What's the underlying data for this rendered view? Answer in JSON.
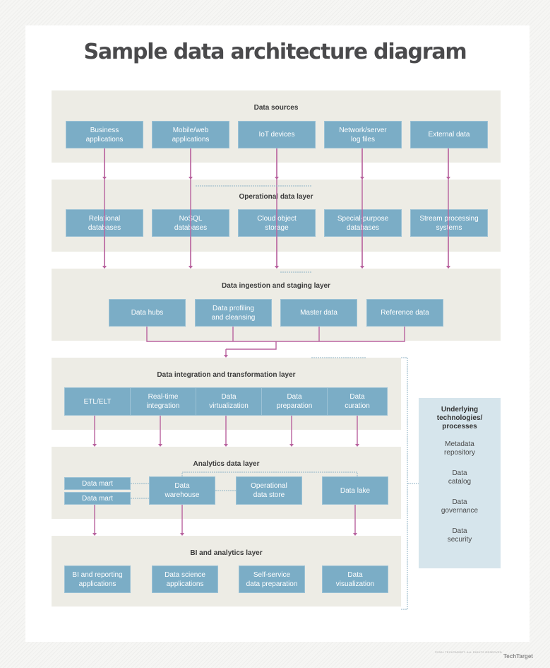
{
  "title": "Sample data architecture diagram",
  "colors": {
    "layer_bg": "#edece5",
    "box_bg": "#7badc6",
    "arrow": "#b8629e",
    "side_bg": "#d6e5ec",
    "dotted": "#8fb3c6"
  },
  "layers": [
    {
      "title": "Data sources",
      "items": [
        "Business\napplications",
        "Mobile/web\napplications",
        "IoT devices",
        "Network/server\nlog files",
        "External data"
      ]
    },
    {
      "title": "Operational data layer",
      "items": [
        "Relational\ndatabases",
        "NoSQL\ndatabases",
        "Cloud object\nstorage",
        "Special-purpose\ndatabases",
        "Stream processing\nsystems"
      ]
    },
    {
      "title": "Data ingestion and staging layer",
      "items": [
        "Data hubs",
        "Data profiling\nand cleansing",
        "Master data",
        "Reference data"
      ]
    },
    {
      "title": "Data integration and transformation layer",
      "items": [
        "ETL/ELT",
        "Real-time\nintegration",
        "Data\nvirtualization",
        "Data\npreparation",
        "Data\ncuration"
      ]
    },
    {
      "title": "Analytics data layer",
      "items": [
        "Data mart",
        "Data mart",
        "Data\nwarehouse",
        "Operational\ndata store",
        "Data lake"
      ]
    },
    {
      "title": "BI and analytics layer",
      "items": [
        "BI and reporting\napplications",
        "Data science\napplications",
        "Self-service\ndata preparation",
        "Data\nvisualization"
      ]
    }
  ],
  "side_panel": {
    "title": "Underlying\ntechnologies/\nprocesses",
    "items": [
      "Metadata\nrepository",
      "Data\ncatalog",
      "Data\ngovernance",
      "Data\nsecurity"
    ]
  },
  "footer": {
    "copyright": "©2024 TECHTARGET. ALL RIGHTS RESERVED",
    "brand": "TechTarget"
  }
}
